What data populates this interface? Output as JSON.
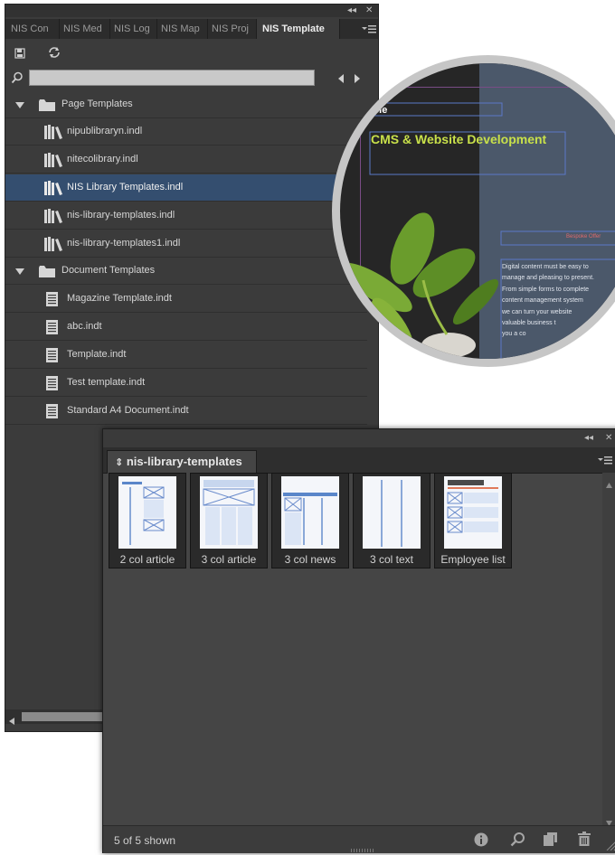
{
  "main_panel": {
    "window_controls": {
      "collapse": "◂◂",
      "close": "✕"
    },
    "tabs": [
      {
        "label": "NIS Con"
      },
      {
        "label": "NIS Med"
      },
      {
        "label": "NIS Log"
      },
      {
        "label": "NIS Map"
      },
      {
        "label": "NIS Proj"
      },
      {
        "label": "NIS Template"
      }
    ],
    "search": {
      "value": "",
      "placeholder": ""
    },
    "tree": [
      {
        "label": "Page Templates",
        "type": "folder"
      },
      {
        "label": "nipublibraryn.indl",
        "type": "library"
      },
      {
        "label": "nitecolibrary.indl",
        "type": "library"
      },
      {
        "label": "NIS Library Templates.indl",
        "type": "library",
        "selected": true
      },
      {
        "label": "nis-library-templates.indl",
        "type": "library"
      },
      {
        "label": "nis-library-templates1.indl",
        "type": "library"
      },
      {
        "label": "Document Templates",
        "type": "folder"
      },
      {
        "label": "Magazine Template.indt",
        "type": "document"
      },
      {
        "label": "abc.indt",
        "type": "document"
      },
      {
        "label": "Template.indt",
        "type": "document"
      },
      {
        "label": "Test template.indt",
        "type": "document"
      },
      {
        "label": "Standard A4 Document.indt",
        "type": "document"
      }
    ]
  },
  "preview": {
    "heading_partial": "icle",
    "title": "CMS & Website Development",
    "tag": "Bespoke Offer",
    "body_lines": [
      "Digital content must be easy to",
      "manage and pleasing to present.",
      "From simple forms to complete",
      "content management system",
      "we can turn your website",
      "valuable business t",
      "you a co"
    ],
    "colors": {
      "title": "#c8e04a",
      "frame": "#5b79c8",
      "tag": "#e06a6a"
    }
  },
  "library_panel": {
    "window_controls": {
      "collapse": "◂◂",
      "close": "✕"
    },
    "tab_label": "nis-library-templates",
    "items": [
      {
        "caption": "2 col article"
      },
      {
        "caption": "3 col article"
      },
      {
        "caption": "3 col news"
      },
      {
        "caption": "3 col text"
      },
      {
        "caption": "Employee list"
      }
    ],
    "status_text": "5 of 5 shown"
  }
}
